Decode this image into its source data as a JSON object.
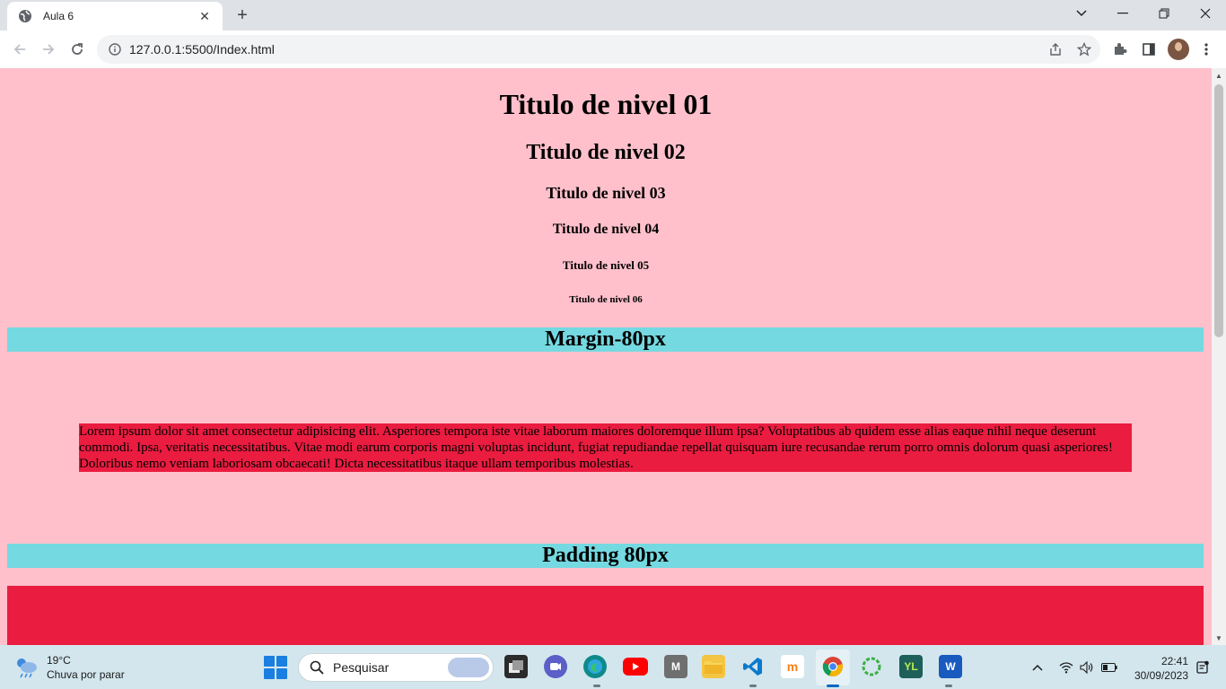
{
  "browser": {
    "tab_title": "Aula 6",
    "url": "127.0.0.1:5500/Index.html"
  },
  "page": {
    "headings": [
      "Titulo de nivel 01",
      "Titulo de nivel 02",
      "Titulo de nivel 03",
      "Titulo de nivel 04",
      "Titulo de nivel 05",
      "Titulo de nivel 06"
    ],
    "margin_title": "Margin-80px",
    "lorem": "Lorem ipsum dolor sit amet consectetur adipisicing elit. Asperiores tempora iste vitae laborum maiores doloremque illum ipsa? Voluptatibus ab quidem esse alias eaque nihil neque deserunt commodi. Ipsa, veritatis necessitatibus. Vitae modi earum corporis magni voluptas incidunt, fugiat repudiandae repellat quisquam iure recusandae rerum porro omnis dolorum quasi asperiores! Doloribus nemo veniam laboriosam obcaecati! Dicta necessitatibus itaque ullam temporibus molestias.",
    "padding_title": "Padding 80px",
    "colors": {
      "background": "#ffc0cb",
      "bar": "#74d9e1",
      "red": "#ea1c40"
    }
  },
  "taskbar": {
    "weather_temp": "19°C",
    "weather_desc": "Chuva por parar",
    "search_label": "Pesquisar",
    "time": "22:41",
    "date": "30/09/2023"
  }
}
